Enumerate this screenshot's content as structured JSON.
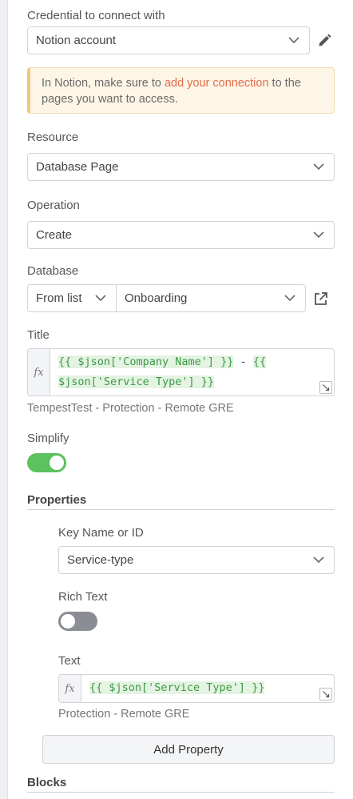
{
  "credential": {
    "label": "Credential to connect with",
    "value": "Notion account",
    "edit_icon": "pencil-icon"
  },
  "notice": {
    "before": "In Notion, make sure to ",
    "link": "add your connection",
    "after": " to the pages you want to access.",
    "line2": "pages you want to access."
  },
  "resource": {
    "label": "Resource",
    "value": "Database Page"
  },
  "operation": {
    "label": "Operation",
    "value": "Create"
  },
  "database": {
    "label": "Database",
    "mode": "From list",
    "value": "Onboarding",
    "open_icon": "external-link-icon"
  },
  "title": {
    "label": "Title",
    "expr_line1_part1": "{{ $json['Company Name'] }}",
    "expr_line1_sep": " - ",
    "expr_line1_part2": "{{",
    "expr_line2": "$json['Service Type'] }}",
    "preview": "TempestTest -  Protection - Remote GRE"
  },
  "simplify": {
    "label": "Simplify",
    "enabled": true
  },
  "properties": {
    "heading": "Properties",
    "key_label": "Key Name or ID",
    "key_value": "Service-type",
    "rich_text_label": "Rich Text",
    "rich_text_enabled": false,
    "text_label": "Text",
    "text_expr": "{{ $json['Service Type'] }}",
    "text_preview": "Protection - Remote GRE",
    "add_button": "Add Property"
  },
  "blocks": {
    "heading": "Blocks"
  },
  "colors": {
    "accent_green": "#5cc15f",
    "toggle_off": "#8a8d93",
    "link_orange": "#e46a4c"
  }
}
